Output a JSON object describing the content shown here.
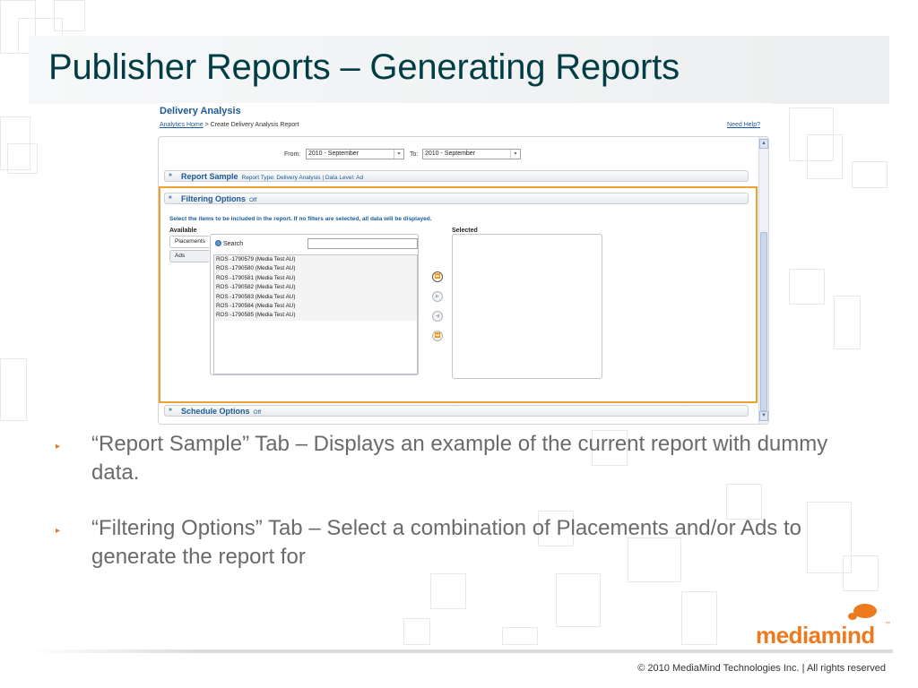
{
  "slide": {
    "title": "Publisher Reports – Generating Reports",
    "bullets": [
      "“Report Sample” Tab – Displays an example of the current report with dummy data.",
      "“Filtering Options” Tab – Select a combination of Placements and/or Ads to generate the report for"
    ],
    "bullet_marker": "▸",
    "copyright": "© 2010 MediaMind Technologies Inc. | All rights reserved",
    "logo_text": "mediamind",
    "logo_tm": "™"
  },
  "app": {
    "page_title": "Delivery Analysis",
    "breadcrumb_link": "Analytics Home",
    "breadcrumb_rest": " > Create Delivery Analysis Report",
    "help_link": "Need Help?",
    "from_label": "From:",
    "from_value": "2010 - September",
    "to_label": "To:",
    "to_value": "2010 - September",
    "sections": {
      "report_sample": {
        "label": "Report Sample",
        "sub": "Report Type: Delivery Analysis | Data Level: Ad"
      },
      "filtering_options": {
        "label": "Filtering Options",
        "sub": "Off"
      },
      "schedule_options": {
        "label": "Schedule Options",
        "sub": "Off"
      }
    },
    "instruction": "Select the items to be included in the report. If no filters are selected, all data will be displayed.",
    "available_label": "Available",
    "selected_label": "Selected",
    "tabs": [
      "Placements",
      "Ads"
    ],
    "search_label": "Search",
    "available_items": [
      "ROS -1790579 (Media Test AU)",
      "ROS -1790580 (Media Test AU)",
      "ROS -1790581 (Media Test AU)",
      "ROS -1790582 (Media Test AU)",
      "ROS -1790583 (Media Test AU)",
      "ROS -1790584 (Media Test AU)",
      "ROS -1790585 (Media Test AU)"
    ],
    "move_buttons": [
      "⏩",
      "▶",
      "◀",
      "⏪"
    ]
  },
  "colors": {
    "title": "#003e44",
    "app_link": "#1b5a96",
    "highlight_border": "#f0a030",
    "brand_orange": "#ee7a1f",
    "bullet_text": "#6a6a6a"
  }
}
